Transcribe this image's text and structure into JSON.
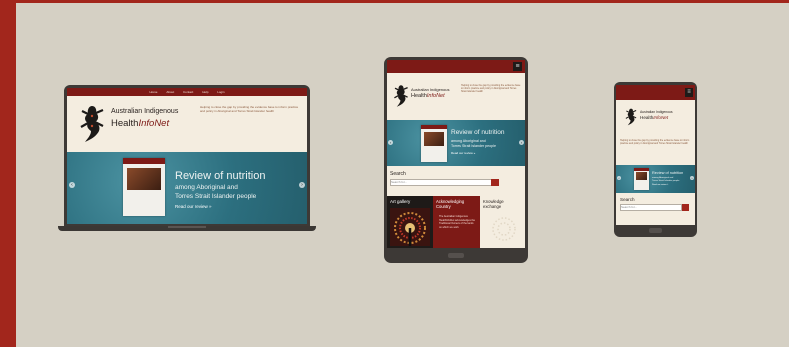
{
  "site": {
    "logo_line1": "Australian Indigenous",
    "logo_line2_a": "Health",
    "logo_line2_b": "InfoNet",
    "tagline": "Helping to close the gap by providing the evidence base to inform practice and policy in Aboriginal and Torres Strait Islander health",
    "nav": [
      "Home",
      "About",
      "Contact",
      "Help",
      "Login"
    ]
  },
  "promo": {
    "title": "Review of nutrition",
    "subtitle_line1": "among Aboriginal and",
    "subtitle_line2": "Torres Strait Islander people",
    "read_more": "Read our review »"
  },
  "search": {
    "label": "Search",
    "placeholder": "Search for..."
  },
  "tiles": [
    {
      "title": "Art gallery",
      "bg": "#1e1a18"
    },
    {
      "title": "Acknowledging Country",
      "text": "The Australian Indigenous HealthInfoNet acknowledges the Traditional Owners of the lands on which we work",
      "bg": "#7d1a16"
    },
    {
      "title": "Knowledge exchange",
      "bg": "#f4ede0"
    }
  ],
  "colors": {
    "frame": "#a2261c",
    "brand": "#7d1a16",
    "teal": "#2c6f7f",
    "device": "#3d3936"
  }
}
